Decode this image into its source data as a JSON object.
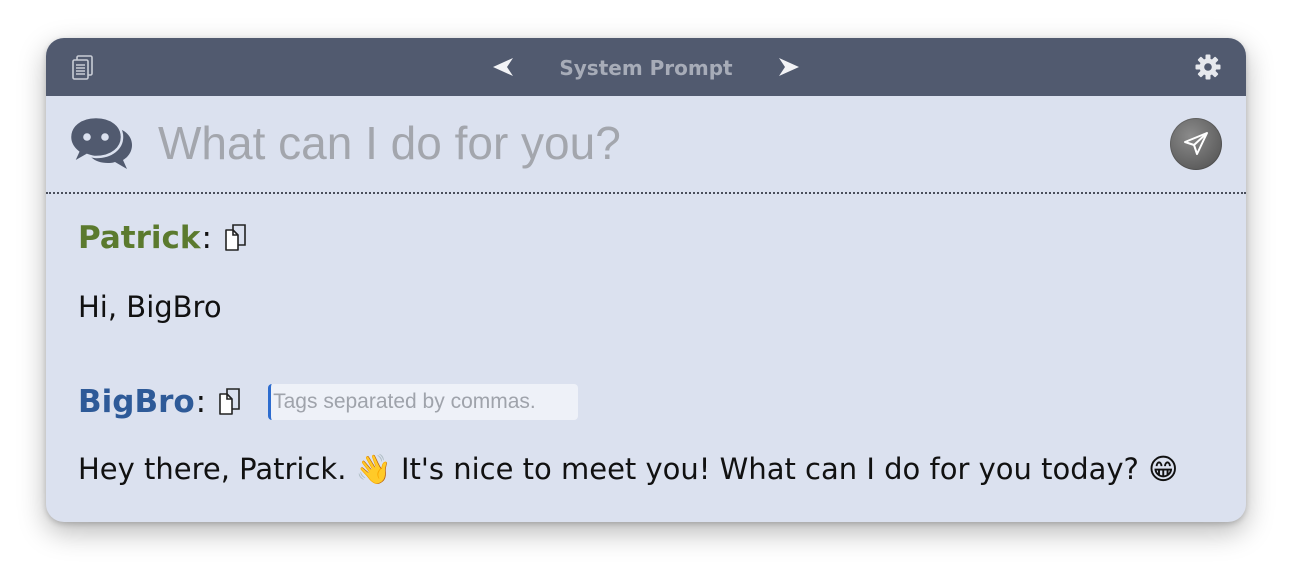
{
  "titlebar": {
    "title": "System Prompt",
    "prev_icon": "chevron-left-icon",
    "next_icon": "chevron-right-icon",
    "copy_all_icon": "copy-all-icon",
    "settings_icon": "gear-icon"
  },
  "composer": {
    "placeholder": "What can I do for you?",
    "value": "",
    "chat_icon": "chat-bubbles-icon",
    "send_icon": "paper-plane-icon"
  },
  "messages": [
    {
      "sender": "Patrick",
      "colon": ":",
      "text": "Hi, BigBro",
      "color": "#5b7a2e"
    },
    {
      "sender": "BigBro",
      "colon": ":",
      "text": "Hey there, Patrick. 👋 It's nice to meet you! What can I do for you today? 😁",
      "color": "#2e5a98",
      "tags_placeholder": "Tags separated by commas."
    }
  ],
  "colors": {
    "titlebar": "#515a6f",
    "background": "#dbe1ef",
    "title_text": "#a7acb8"
  }
}
